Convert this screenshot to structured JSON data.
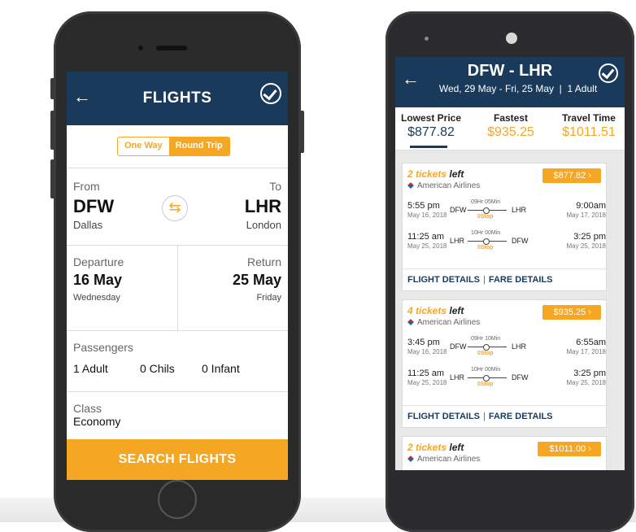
{
  "left_app": {
    "header": {
      "title": "FLIGHTS",
      "back_icon": "back-arrow-icon",
      "confirm_icon": "check-circle-icon"
    },
    "trip_type": {
      "options": [
        "One Way",
        "Round Trip"
      ],
      "selected": "Round Trip"
    },
    "route": {
      "from_label": "From",
      "from_code": "DFW",
      "from_city": "Dallas",
      "to_label": "To",
      "to_code": "LHR",
      "to_city": "London",
      "swap_icon": "swap-arrows-icon"
    },
    "dates": {
      "departure_label": "Departure",
      "departure_date": "16 May",
      "departure_day": "Wednesday",
      "return_label": "Return",
      "return_date": "25 May",
      "return_day": "Friday"
    },
    "passengers": {
      "label": "Passengers",
      "adult": "1 Adult",
      "child": "0 Chils",
      "infant": "0 Infant"
    },
    "class": {
      "label": "Class",
      "value": "Economy"
    },
    "search_button": "SEARCH FLIGHTS"
  },
  "right_app": {
    "header": {
      "title": "DFW - LHR",
      "subtitle": "Wed, 29 May - Fri, 25 May  |  1 Adult"
    },
    "sort_tabs": [
      {
        "label": "Lowest Price",
        "value": "$877.82",
        "color": "#1a3a5c"
      },
      {
        "label": "Fastest",
        "value": "$935.25",
        "color": "#f5a623"
      },
      {
        "label": "Travel Time",
        "value": "$1011.51",
        "color": "#f5a623"
      }
    ],
    "results": [
      {
        "tickets_count": "2 tickets",
        "tickets_suffix": "left",
        "airline": "American Airlines",
        "price": "$877.82",
        "outbound": {
          "dep_time": "5:55 pm",
          "dep_date": "May 16, 2018",
          "from": "DFW",
          "duration": "09Hr 05Min",
          "stops": "0Stop",
          "to": "LHR",
          "arr_time": "9:00am",
          "arr_date": "May 17, 2018"
        },
        "inbound": {
          "dep_time": "11:25 am",
          "dep_date": "May 25, 2018",
          "from": "LHR",
          "duration": "10Hr 00Min",
          "stops": "0Stop",
          "to": "DFW",
          "arr_time": "3:25 pm",
          "arr_date": "May 25, 2018"
        },
        "links": [
          "FLIGHT DETAILS",
          "FARE DETAILS"
        ]
      },
      {
        "tickets_count": "4 tickets",
        "tickets_suffix": "left",
        "airline": "American Airlines",
        "price": "$935.25",
        "outbound": {
          "dep_time": "3:45 pm",
          "dep_date": "May 16, 2018",
          "from": "DFW",
          "duration": "09Hr 10Min",
          "stops": "0Stop",
          "to": "LHR",
          "arr_time": "6:55am",
          "arr_date": "May 17, 2018"
        },
        "inbound": {
          "dep_time": "11:25 am",
          "dep_date": "May 25, 2018",
          "from": "LHR",
          "duration": "10Hr 00Min",
          "stops": "0Stop",
          "to": "DFW",
          "arr_time": "3:25 pm",
          "arr_date": "May 25, 2018"
        },
        "links": [
          "FLIGHT DETAILS",
          "FARE DETAILS"
        ]
      },
      {
        "tickets_count": "2 tickets",
        "tickets_suffix": "left",
        "airline": "American Airlines",
        "price": "$1011.00"
      }
    ],
    "link_separator": "|"
  }
}
